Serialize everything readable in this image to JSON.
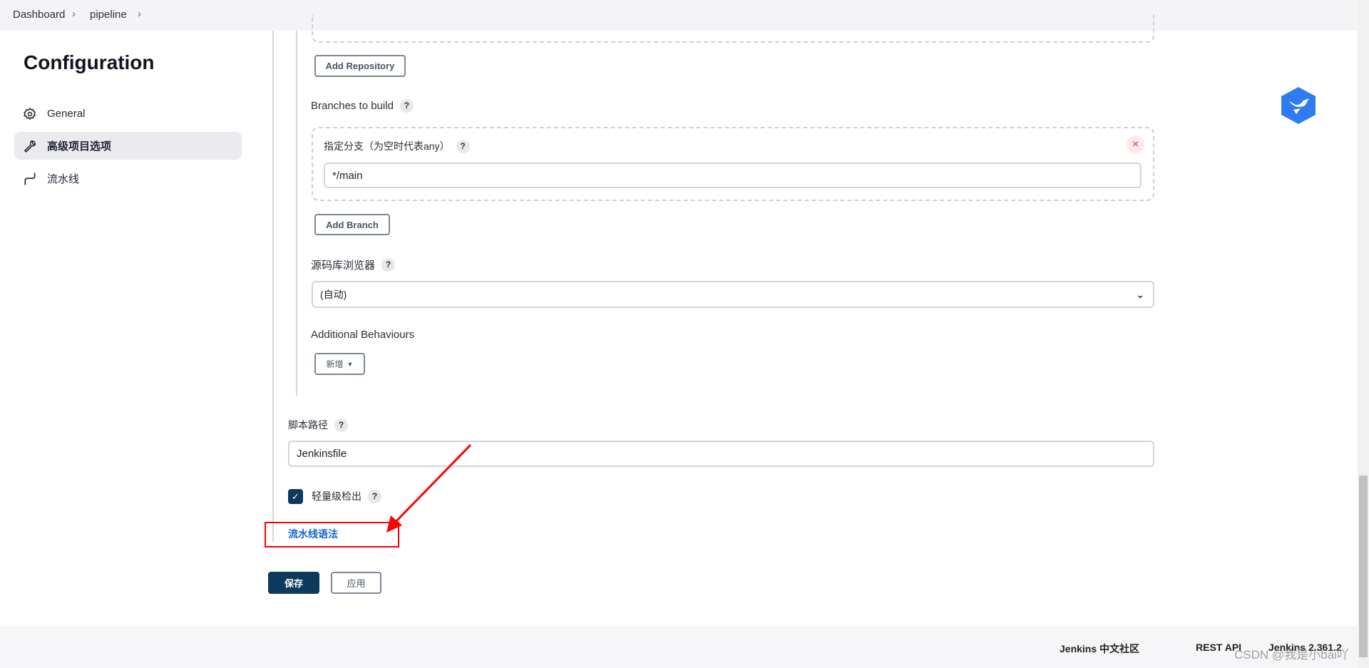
{
  "breadcrumb": [
    "Dashboard",
    "pipeline"
  ],
  "sidebar": {
    "title": "Configuration",
    "items": [
      {
        "label": "General",
        "icon": "gear-icon"
      },
      {
        "label": "高级项目选项",
        "icon": "wrench-icon",
        "active": true
      },
      {
        "label": "流水线",
        "icon": "pipeline-icon"
      }
    ]
  },
  "scm": {
    "add_repository": "Add Repository",
    "branches_label": "Branches to build",
    "branch_spec_label": "指定分支（为空时代表any）",
    "branch_spec_value": "*/main",
    "add_branch": "Add Branch",
    "browser_label": "源码库浏览器",
    "browser_value": "(自动)",
    "behaviours_label": "Additional Behaviours",
    "add_label": "新增"
  },
  "script_path": {
    "label": "脚本路径",
    "value": "Jenkinsfile"
  },
  "lightweight": {
    "label": "轻量级检出",
    "checked": true
  },
  "pipeline_syntax_link": "流水线语法",
  "actions": {
    "save": "保存",
    "apply": "应用"
  },
  "footer": {
    "community": "Jenkins 中文社区",
    "rest_api": "REST API",
    "version": "Jenkins 2.361.2"
  },
  "watermark": "CSDN @我是小bai吖",
  "colors": {
    "primary": "#0b3a5d",
    "link": "#1466c9",
    "annotation": "#ff0000"
  }
}
